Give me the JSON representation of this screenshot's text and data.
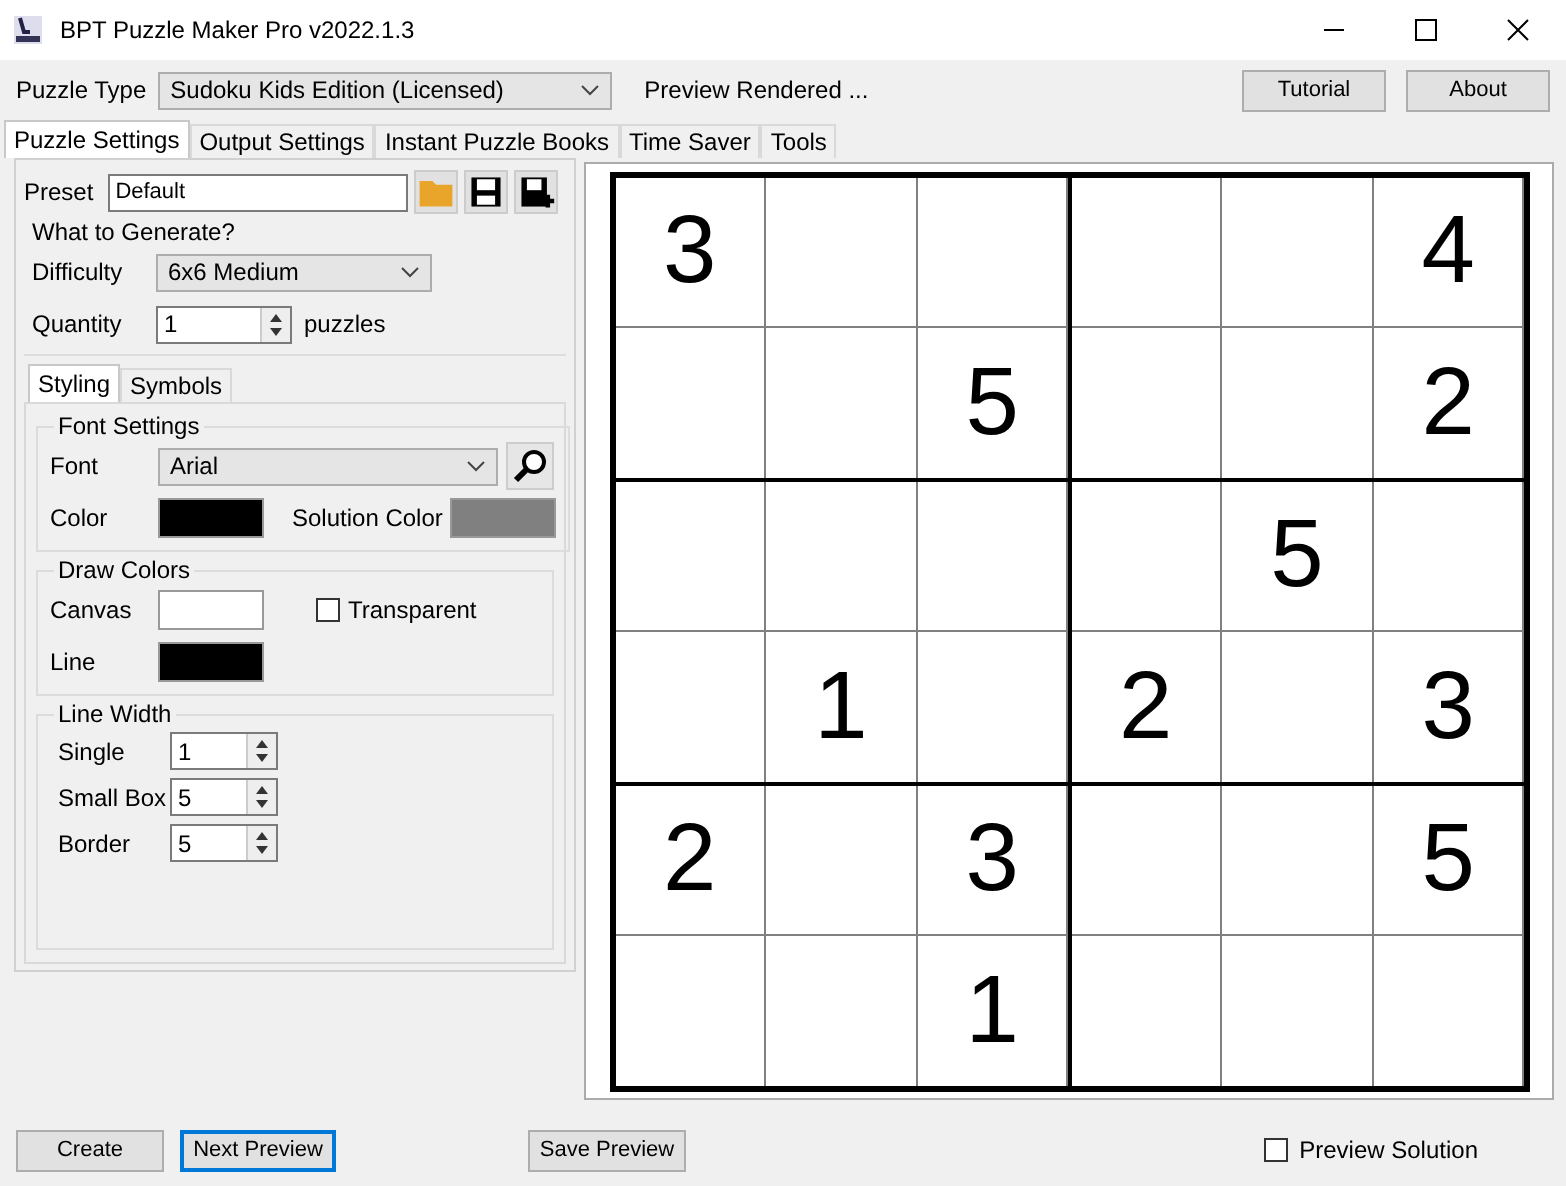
{
  "window": {
    "title": "BPT Puzzle Maker Pro v2022.1.3"
  },
  "toolbar": {
    "puzzle_type_label": "Puzzle Type",
    "puzzle_type": "Sudoku Kids Edition (Licensed)",
    "status": "Preview Rendered ...",
    "buttons": [
      "Tutorial",
      "About"
    ]
  },
  "tabs": [
    {
      "label": "Puzzle Settings",
      "selected": true
    },
    {
      "label": "Output Settings",
      "selected": false
    },
    {
      "label": "Instant Puzzle Books",
      "selected": false
    },
    {
      "label": "Time Saver",
      "selected": false
    },
    {
      "label": "Tools",
      "selected": false
    }
  ],
  "preset": {
    "label": "Preset",
    "value": "Default"
  },
  "generate": {
    "title": "What to Generate?",
    "difficulty_label": "Difficulty",
    "difficulty": "6x6 Medium",
    "quantity_label": "Quantity",
    "quantity": "1",
    "quantity_unit": "puzzles"
  },
  "subtabs": [
    {
      "label": "Styling",
      "selected": true
    },
    {
      "label": "Symbols",
      "selected": false
    }
  ],
  "font_settings": {
    "title": "Font Settings",
    "font_label": "Font",
    "font": "Arial",
    "swatches": [
      {
        "label": "Color",
        "color": "#000000"
      },
      {
        "label": "Solution Color",
        "color": "#808080"
      }
    ]
  },
  "draw_colors": {
    "title": "Draw Colors",
    "swatches": [
      {
        "label": "Canvas",
        "color": "#ffffff"
      },
      {
        "label": "Line",
        "color": "#000000"
      }
    ],
    "transparent_label": "Transparent",
    "transparent": false
  },
  "line_width": {
    "title": "Line Width",
    "fields": [
      {
        "label": "Single",
        "value": "1"
      },
      {
        "label": "Small Box",
        "value": "5"
      },
      {
        "label": "Border",
        "value": "5"
      }
    ]
  },
  "grid": [
    {
      "col_1": "3",
      "col_6": "4"
    },
    {
      "col_3": "5",
      "col_6": "2"
    },
    {
      "col_5": "5"
    },
    {
      "col_2": "1",
      "col_4": "2",
      "col_6": "3"
    },
    {
      "col_1": "2",
      "col_3": "3",
      "col_6": "5"
    },
    {
      "col_3": "1"
    }
  ],
  "bottom": {
    "buttons": [
      {
        "label": "Create",
        "selected": false
      },
      {
        "label": "Next Preview",
        "selected": true
      },
      {
        "label": "Save Preview",
        "selected": false
      }
    ],
    "preview_solution_label": "Preview Solution",
    "preview_solution": false
  }
}
